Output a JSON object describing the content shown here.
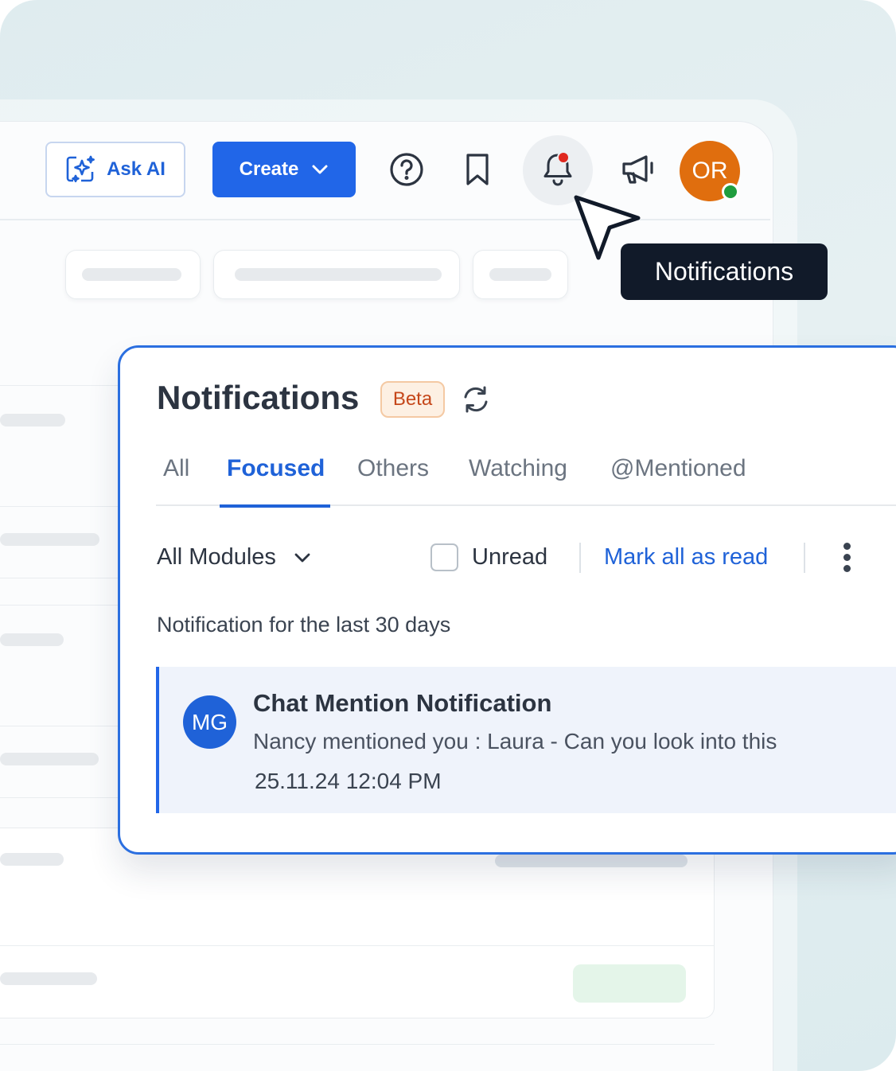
{
  "topbar": {
    "ask_ai_label": "Ask AI",
    "create_label": "Create",
    "user_initials": "OR",
    "tooltip": "Notifications",
    "has_unread_notifications": true,
    "user_online": true
  },
  "panel": {
    "title": "Notifications",
    "badge": "Beta",
    "tabs": [
      {
        "label": "All",
        "active": false
      },
      {
        "label": "Focused",
        "active": true
      },
      {
        "label": "Others",
        "active": false
      },
      {
        "label": "Watching",
        "active": false
      },
      {
        "label": "@Mentioned",
        "active": false
      }
    ],
    "filter": {
      "modules_label": "All Modules",
      "unread_label": "Unread",
      "unread_checked": false,
      "mark_all_label": "Mark all as read"
    },
    "range_text": "Notification for the last 30 days",
    "notifications": [
      {
        "initials": "MG",
        "title": "Chat Mention Notification",
        "body": "Nancy mentioned you : Laura - Can you look into this",
        "time": "25.11.24 12:04 PM"
      }
    ]
  },
  "colors": {
    "accent": "#2166e8",
    "avatar_user": "#e06e0e",
    "online": "#1f9d3e",
    "notification_dot": "#e0281f",
    "beta_text": "#c5471a",
    "tooltip_bg": "#111a29"
  },
  "icons": [
    "sparkle-icon",
    "chevron-down-icon",
    "help-icon",
    "bookmark-icon",
    "bell-icon",
    "megaphone-icon",
    "refresh-icon",
    "kebab-menu-icon",
    "cursor-pointer-icon"
  ]
}
